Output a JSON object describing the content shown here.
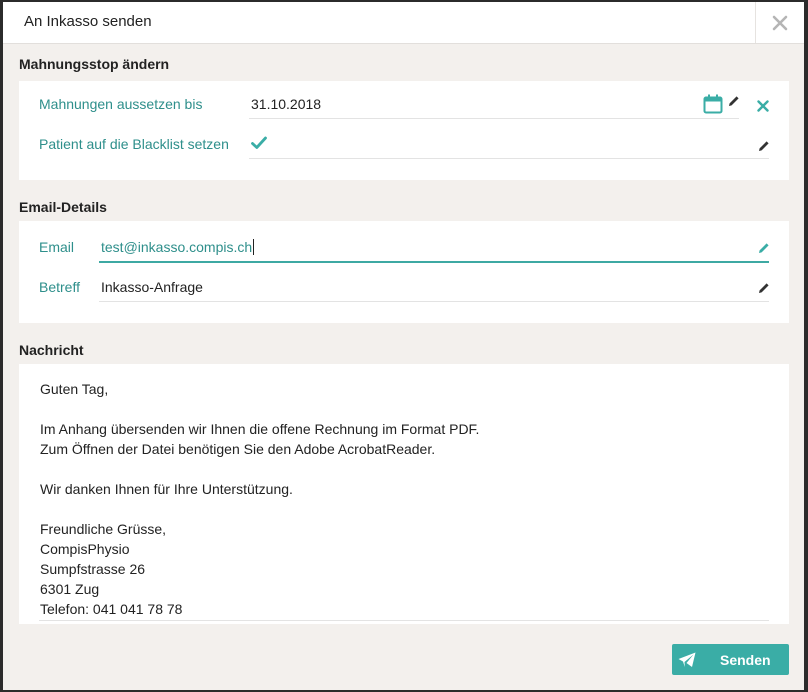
{
  "dialog": {
    "title": "An Inkasso senden"
  },
  "mahnungsstop": {
    "heading": "Mahnungsstop ändern",
    "aussetzen_label": "Mahnungen aussetzen bis",
    "aussetzen_value": "31.10.2018",
    "blacklist_label": "Patient auf die Blacklist setzen",
    "blacklist_checked": true
  },
  "email_details": {
    "heading": "Email-Details",
    "email_label": "Email",
    "email_value": "test@inkasso.compis.ch",
    "betreff_label": "Betreff",
    "betreff_value": "Inkasso-Anfrage"
  },
  "nachricht": {
    "heading": "Nachricht",
    "lines": [
      "Guten Tag,",
      "",
      "Im Anhang übersenden wir Ihnen die offene Rechnung im Format PDF.",
      "Zum Öffnen der Datei benötigen Sie den Adobe AcrobatReader.",
      "",
      "Wir danken Ihnen für Ihre Unterstützung.",
      "",
      "Freundliche Grüsse,",
      "CompisPhysio",
      "Sumpfstrasse 26",
      "6301 Zug",
      "Telefon: 041 041 78 78"
    ]
  },
  "footer": {
    "send_label": "Senden"
  },
  "colors": {
    "accent": "#3aada6",
    "label_teal": "#2e8f8b",
    "background": "#f3f0ed"
  },
  "icons": {
    "close": "close-icon",
    "calendar": "calendar-icon",
    "edit": "pencil-icon",
    "clear": "clear-x-icon",
    "check": "checkmark-icon",
    "send": "paper-plane-icon"
  }
}
